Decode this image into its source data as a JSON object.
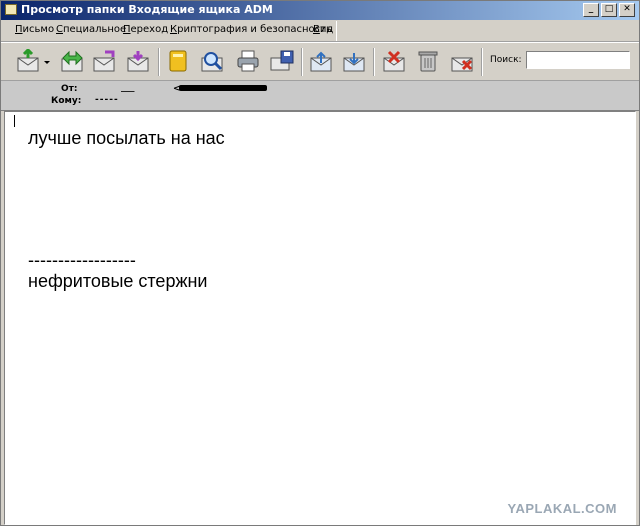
{
  "window": {
    "title": "Просмотр папки Входящие ящика ADM",
    "controls": {
      "minimize": "_",
      "maximize": "□",
      "close": "✕"
    }
  },
  "menu": {
    "items": [
      "Письмо",
      "Специальное",
      "Переход",
      "Криптография и безопасность",
      "Вид"
    ]
  },
  "toolbar": {
    "icons": [
      "mail-receive-icon",
      "dropdown-arrow-icon",
      "forward-green-icon",
      "mail-open-icon",
      "mail-envelope-icon",
      "notebook-icon",
      "find-mail-icon",
      "printer-icon",
      "save-mail-icon",
      "mail-up-icon",
      "mail-check-icon",
      "delete-mail-icon",
      "trash-icon",
      "mail-cross-icon"
    ],
    "search_label": "Поиск:",
    "search_value": ""
  },
  "header": {
    "from_label": "От:",
    "from_value": "___",
    "from_email_fragment": "<",
    "to_label": "Кому:",
    "to_value": "-----"
  },
  "message": {
    "line1": "лучше посылать на нас",
    "separator": "------------------",
    "line2": "нефритовые стержни"
  },
  "watermark": "YAPLAKAL.COM"
}
